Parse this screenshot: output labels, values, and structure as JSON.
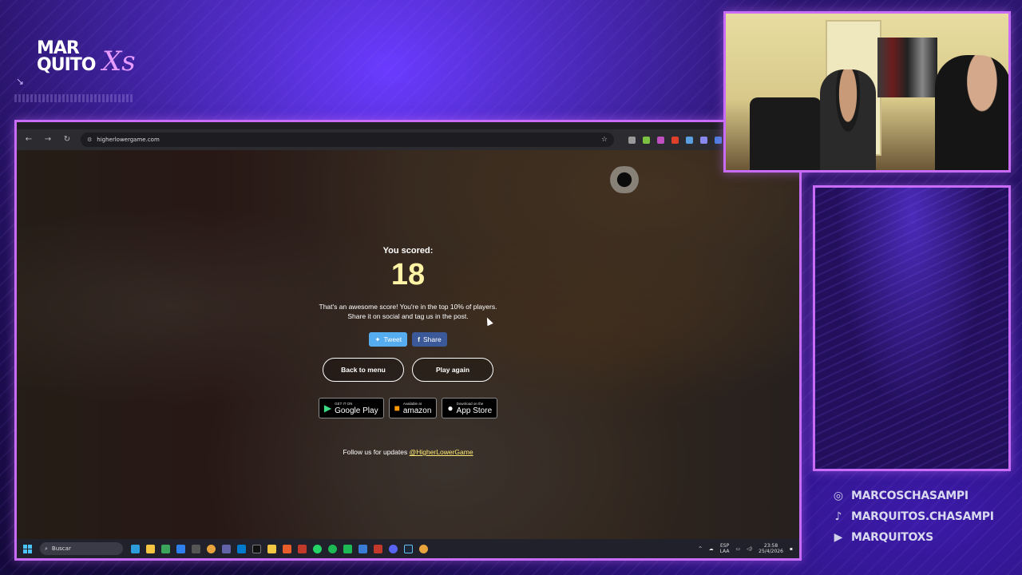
{
  "overlay": {
    "logo_line1": "MAR",
    "logo_line2": "QUITO",
    "logo_script": "Xs",
    "socials": [
      {
        "icon": "instagram-icon",
        "handle": "MARCOSCHASAMPI"
      },
      {
        "icon": "tiktok-icon",
        "handle": "MARQUITOS.CHASAMPI"
      },
      {
        "icon": "youtube-icon",
        "handle": "MARQUITOXS"
      }
    ],
    "accent_color": "#c86cf7"
  },
  "browser": {
    "url": "higherlowergame.com"
  },
  "game": {
    "scored_label": "You scored:",
    "score": "18",
    "message_line1": "That's an awesome score! You're in the top 10% of players.",
    "message_line2": "Share it on social and tag us in the post.",
    "tweet_label": "Tweet",
    "share_label": "Share",
    "back_label": "Back to menu",
    "play_again_label": "Play again",
    "stores": [
      {
        "small": "GET IT ON",
        "big": "Google Play",
        "icon": "play-store-icon"
      },
      {
        "small": "Available at",
        "big": "amazon",
        "icon": "amazon-icon"
      },
      {
        "small": "Download on the",
        "big": "App Store",
        "icon": "apple-icon"
      }
    ],
    "follow_text": "Follow us for updates ",
    "follow_handle": "@HigherLowerGame",
    "score_color": "#fff3a6",
    "link_color": "#ffe977"
  },
  "taskbar": {
    "search_placeholder": "Buscar",
    "lang_line1": "ESP",
    "lang_line2": "LAA",
    "time": "23:58",
    "date": "25/4/2026"
  }
}
